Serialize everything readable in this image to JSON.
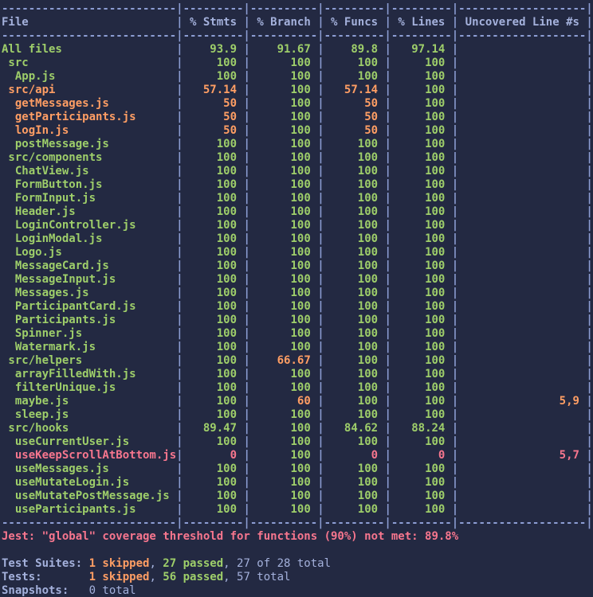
{
  "palette": {
    "background": "#232942",
    "border": "#8c9dd3",
    "header_text": "#a4b1dc",
    "text": "#a4b1dc",
    "green": "#9ece6a",
    "orange": "#ff9e64",
    "red": "#f7768e"
  },
  "coverage_table": {
    "columns": [
      {
        "label": "File",
        "width": 26,
        "align": "left"
      },
      {
        "label": "% Stmts",
        "width": 9
      },
      {
        "label": "% Branch",
        "width": 10
      },
      {
        "label": "% Funcs",
        "width": 9
      },
      {
        "label": "% Lines",
        "width": 9
      },
      {
        "label": "Uncovered Line #s",
        "width": 19
      }
    ],
    "rows": [
      {
        "file": "All files",
        "indent": 0,
        "file_color": "green",
        "cells": [
          [
            "93.9",
            "green"
          ],
          [
            "91.67",
            "green"
          ],
          [
            "89.8",
            "green"
          ],
          [
            "97.14",
            "green"
          ],
          [
            "",
            "text"
          ]
        ]
      },
      {
        "file": "src",
        "indent": 1,
        "file_color": "green",
        "cells": [
          [
            "100",
            "green"
          ],
          [
            "100",
            "green"
          ],
          [
            "100",
            "green"
          ],
          [
            "100",
            "green"
          ],
          [
            "",
            "text"
          ]
        ]
      },
      {
        "file": "App.js",
        "indent": 2,
        "file_color": "green",
        "cells": [
          [
            "100",
            "green"
          ],
          [
            "100",
            "green"
          ],
          [
            "100",
            "green"
          ],
          [
            "100",
            "green"
          ],
          [
            "",
            "text"
          ]
        ]
      },
      {
        "file": "src/api",
        "indent": 1,
        "file_color": "orange",
        "cells": [
          [
            "57.14",
            "orange"
          ],
          [
            "100",
            "green"
          ],
          [
            "57.14",
            "orange"
          ],
          [
            "100",
            "green"
          ],
          [
            "",
            "text"
          ]
        ]
      },
      {
        "file": "getMessages.js",
        "indent": 2,
        "file_color": "orange",
        "cells": [
          [
            "50",
            "orange"
          ],
          [
            "100",
            "green"
          ],
          [
            "50",
            "orange"
          ],
          [
            "100",
            "green"
          ],
          [
            "",
            "text"
          ]
        ]
      },
      {
        "file": "getParticipants.js",
        "indent": 2,
        "file_color": "orange",
        "cells": [
          [
            "50",
            "orange"
          ],
          [
            "100",
            "green"
          ],
          [
            "50",
            "orange"
          ],
          [
            "100",
            "green"
          ],
          [
            "",
            "text"
          ]
        ]
      },
      {
        "file": "logIn.js",
        "indent": 2,
        "file_color": "orange",
        "cells": [
          [
            "50",
            "orange"
          ],
          [
            "100",
            "green"
          ],
          [
            "50",
            "orange"
          ],
          [
            "100",
            "green"
          ],
          [
            "",
            "text"
          ]
        ]
      },
      {
        "file": "postMessage.js",
        "indent": 2,
        "file_color": "green",
        "cells": [
          [
            "100",
            "green"
          ],
          [
            "100",
            "green"
          ],
          [
            "100",
            "green"
          ],
          [
            "100",
            "green"
          ],
          [
            "",
            "text"
          ]
        ]
      },
      {
        "file": "src/components",
        "indent": 1,
        "file_color": "green",
        "cells": [
          [
            "100",
            "green"
          ],
          [
            "100",
            "green"
          ],
          [
            "100",
            "green"
          ],
          [
            "100",
            "green"
          ],
          [
            "",
            "text"
          ]
        ]
      },
      {
        "file": "ChatView.js",
        "indent": 2,
        "file_color": "green",
        "cells": [
          [
            "100",
            "green"
          ],
          [
            "100",
            "green"
          ],
          [
            "100",
            "green"
          ],
          [
            "100",
            "green"
          ],
          [
            "",
            "text"
          ]
        ]
      },
      {
        "file": "FormButton.js",
        "indent": 2,
        "file_color": "green",
        "cells": [
          [
            "100",
            "green"
          ],
          [
            "100",
            "green"
          ],
          [
            "100",
            "green"
          ],
          [
            "100",
            "green"
          ],
          [
            "",
            "text"
          ]
        ]
      },
      {
        "file": "FormInput.js",
        "indent": 2,
        "file_color": "green",
        "cells": [
          [
            "100",
            "green"
          ],
          [
            "100",
            "green"
          ],
          [
            "100",
            "green"
          ],
          [
            "100",
            "green"
          ],
          [
            "",
            "text"
          ]
        ]
      },
      {
        "file": "Header.js",
        "indent": 2,
        "file_color": "green",
        "cells": [
          [
            "100",
            "green"
          ],
          [
            "100",
            "green"
          ],
          [
            "100",
            "green"
          ],
          [
            "100",
            "green"
          ],
          [
            "",
            "text"
          ]
        ]
      },
      {
        "file": "LoginController.js",
        "indent": 2,
        "file_color": "green",
        "cells": [
          [
            "100",
            "green"
          ],
          [
            "100",
            "green"
          ],
          [
            "100",
            "green"
          ],
          [
            "100",
            "green"
          ],
          [
            "",
            "text"
          ]
        ]
      },
      {
        "file": "LoginModal.js",
        "indent": 2,
        "file_color": "green",
        "cells": [
          [
            "100",
            "green"
          ],
          [
            "100",
            "green"
          ],
          [
            "100",
            "green"
          ],
          [
            "100",
            "green"
          ],
          [
            "",
            "text"
          ]
        ]
      },
      {
        "file": "Logo.js",
        "indent": 2,
        "file_color": "green",
        "cells": [
          [
            "100",
            "green"
          ],
          [
            "100",
            "green"
          ],
          [
            "100",
            "green"
          ],
          [
            "100",
            "green"
          ],
          [
            "",
            "text"
          ]
        ]
      },
      {
        "file": "MessageCard.js",
        "indent": 2,
        "file_color": "green",
        "cells": [
          [
            "100",
            "green"
          ],
          [
            "100",
            "green"
          ],
          [
            "100",
            "green"
          ],
          [
            "100",
            "green"
          ],
          [
            "",
            "text"
          ]
        ]
      },
      {
        "file": "MessageInput.js",
        "indent": 2,
        "file_color": "green",
        "cells": [
          [
            "100",
            "green"
          ],
          [
            "100",
            "green"
          ],
          [
            "100",
            "green"
          ],
          [
            "100",
            "green"
          ],
          [
            "",
            "text"
          ]
        ]
      },
      {
        "file": "Messages.js",
        "indent": 2,
        "file_color": "green",
        "cells": [
          [
            "100",
            "green"
          ],
          [
            "100",
            "green"
          ],
          [
            "100",
            "green"
          ],
          [
            "100",
            "green"
          ],
          [
            "",
            "text"
          ]
        ]
      },
      {
        "file": "ParticipantCard.js",
        "indent": 2,
        "file_color": "green",
        "cells": [
          [
            "100",
            "green"
          ],
          [
            "100",
            "green"
          ],
          [
            "100",
            "green"
          ],
          [
            "100",
            "green"
          ],
          [
            "",
            "text"
          ]
        ]
      },
      {
        "file": "Participants.js",
        "indent": 2,
        "file_color": "green",
        "cells": [
          [
            "100",
            "green"
          ],
          [
            "100",
            "green"
          ],
          [
            "100",
            "green"
          ],
          [
            "100",
            "green"
          ],
          [
            "",
            "text"
          ]
        ]
      },
      {
        "file": "Spinner.js",
        "indent": 2,
        "file_color": "green",
        "cells": [
          [
            "100",
            "green"
          ],
          [
            "100",
            "green"
          ],
          [
            "100",
            "green"
          ],
          [
            "100",
            "green"
          ],
          [
            "",
            "text"
          ]
        ]
      },
      {
        "file": "Watermark.js",
        "indent": 2,
        "file_color": "green",
        "cells": [
          [
            "100",
            "green"
          ],
          [
            "100",
            "green"
          ],
          [
            "100",
            "green"
          ],
          [
            "100",
            "green"
          ],
          [
            "",
            "text"
          ]
        ]
      },
      {
        "file": "src/helpers",
        "indent": 1,
        "file_color": "green",
        "cells": [
          [
            "100",
            "green"
          ],
          [
            "66.67",
            "orange"
          ],
          [
            "100",
            "green"
          ],
          [
            "100",
            "green"
          ],
          [
            "",
            "text"
          ]
        ]
      },
      {
        "file": "arrayFilledWith.js",
        "indent": 2,
        "file_color": "green",
        "cells": [
          [
            "100",
            "green"
          ],
          [
            "100",
            "green"
          ],
          [
            "100",
            "green"
          ],
          [
            "100",
            "green"
          ],
          [
            "",
            "text"
          ]
        ]
      },
      {
        "file": "filterUnique.js",
        "indent": 2,
        "file_color": "green",
        "cells": [
          [
            "100",
            "green"
          ],
          [
            "100",
            "green"
          ],
          [
            "100",
            "green"
          ],
          [
            "100",
            "green"
          ],
          [
            "",
            "text"
          ]
        ]
      },
      {
        "file": "maybe.js",
        "indent": 2,
        "file_color": "green",
        "cells": [
          [
            "100",
            "green"
          ],
          [
            "60",
            "orange"
          ],
          [
            "100",
            "green"
          ],
          [
            "100",
            "green"
          ],
          [
            "5,9",
            "orange"
          ]
        ]
      },
      {
        "file": "sleep.js",
        "indent": 2,
        "file_color": "green",
        "cells": [
          [
            "100",
            "green"
          ],
          [
            "100",
            "green"
          ],
          [
            "100",
            "green"
          ],
          [
            "100",
            "green"
          ],
          [
            "",
            "text"
          ]
        ]
      },
      {
        "file": "src/hooks",
        "indent": 1,
        "file_color": "green",
        "cells": [
          [
            "89.47",
            "green"
          ],
          [
            "100",
            "green"
          ],
          [
            "84.62",
            "green"
          ],
          [
            "88.24",
            "green"
          ],
          [
            "",
            "text"
          ]
        ]
      },
      {
        "file": "useCurrentUser.js",
        "indent": 2,
        "file_color": "green",
        "cells": [
          [
            "100",
            "green"
          ],
          [
            "100",
            "green"
          ],
          [
            "100",
            "green"
          ],
          [
            "100",
            "green"
          ],
          [
            "",
            "text"
          ]
        ]
      },
      {
        "file": "useKeepScrollAtBottom.js",
        "indent": 2,
        "file_color": "red",
        "cells": [
          [
            "0",
            "red"
          ],
          [
            "100",
            "green"
          ],
          [
            "0",
            "red"
          ],
          [
            "0",
            "red"
          ],
          [
            "5,7",
            "red"
          ]
        ]
      },
      {
        "file": "useMessages.js",
        "indent": 2,
        "file_color": "green",
        "cells": [
          [
            "100",
            "green"
          ],
          [
            "100",
            "green"
          ],
          [
            "100",
            "green"
          ],
          [
            "100",
            "green"
          ],
          [
            "",
            "text"
          ]
        ]
      },
      {
        "file": "useMutateLogin.js",
        "indent": 2,
        "file_color": "green",
        "cells": [
          [
            "100",
            "green"
          ],
          [
            "100",
            "green"
          ],
          [
            "100",
            "green"
          ],
          [
            "100",
            "green"
          ],
          [
            "",
            "text"
          ]
        ]
      },
      {
        "file": "useMutatePostMessage.js",
        "indent": 2,
        "file_color": "green",
        "cells": [
          [
            "100",
            "green"
          ],
          [
            "100",
            "green"
          ],
          [
            "100",
            "green"
          ],
          [
            "100",
            "green"
          ],
          [
            "",
            "text"
          ]
        ]
      },
      {
        "file": "useParticipants.js",
        "indent": 2,
        "file_color": "green",
        "cells": [
          [
            "100",
            "green"
          ],
          [
            "100",
            "green"
          ],
          [
            "100",
            "green"
          ],
          [
            "100",
            "green"
          ],
          [
            "",
            "text"
          ]
        ]
      }
    ]
  },
  "threshold": {
    "text": "Jest: \"global\" coverage threshold for functions (90%) not met: 89.8%",
    "color": "red"
  },
  "summary": {
    "label_width": 13,
    "lines": [
      {
        "label": "Test Suites:",
        "parts": [
          {
            "t": "1 skipped",
            "c": "orange",
            "b": 1
          },
          {
            "t": ", ",
            "c": "text",
            "b": 0
          },
          {
            "t": "27 passed",
            "c": "green",
            "b": 1
          },
          {
            "t": ", 27 of 28 total",
            "c": "text",
            "b": 0
          }
        ]
      },
      {
        "label": "Tests:",
        "parts": [
          {
            "t": "1 skipped",
            "c": "orange",
            "b": 1
          },
          {
            "t": ", ",
            "c": "text",
            "b": 0
          },
          {
            "t": "56 passed",
            "c": "green",
            "b": 1
          },
          {
            "t": ", 57 total",
            "c": "text",
            "b": 0
          }
        ]
      },
      {
        "label": "Snapshots:",
        "parts": [
          {
            "t": "0 total",
            "c": "text",
            "b": 0
          }
        ]
      }
    ]
  }
}
